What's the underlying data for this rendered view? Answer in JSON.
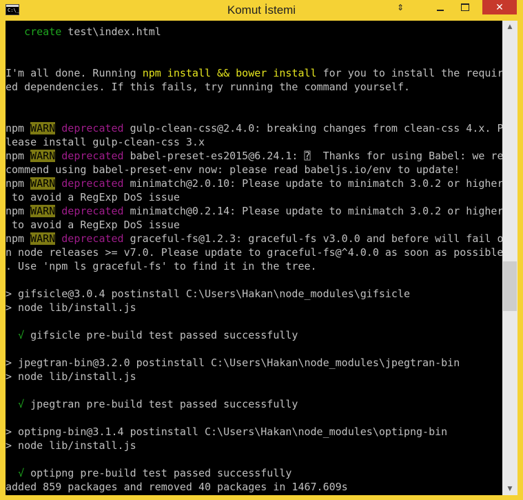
{
  "window": {
    "title": "Komut İstemi",
    "icon_text": "C:\\_",
    "controls": {
      "restore": "⇕",
      "close": "✕"
    }
  },
  "icons": {
    "app": "console-icon",
    "minimize": "minimize-icon",
    "maximize": "maximize-icon",
    "close": "close-icon"
  },
  "colors": {
    "console_bg": "#000000",
    "text": "#c0c0c0",
    "green": "#1ea51e",
    "yellow": "#e5e51f",
    "warn_bg": "#7e7a13",
    "magenta": "#a01c8c",
    "frame": "#f5d235",
    "close_btn": "#c7392c"
  },
  "console": {
    "lines": [
      [
        {
          "t": "   "
        },
        {
          "t": "create",
          "c": "green"
        },
        {
          "t": " test\\index.html"
        }
      ],
      [],
      [],
      [
        {
          "t": "I'm all done. Running "
        },
        {
          "t": "npm install && bower install",
          "c": "yellow"
        },
        {
          "t": " for you to install the requir"
        }
      ],
      [
        {
          "t": "ed dependencies. If this fails, try running the command yourself."
        }
      ],
      [],
      [],
      [
        {
          "t": "npm "
        },
        {
          "t": "WARN",
          "c": "warn"
        },
        {
          "t": " "
        },
        {
          "t": "deprecated",
          "c": "magenta"
        },
        {
          "t": " gulp-clean-css@2.4.0: breaking changes from clean-css 4.x. P"
        }
      ],
      [
        {
          "t": "lease install gulp-clean-css 3.x"
        }
      ],
      [
        {
          "t": "npm "
        },
        {
          "t": "WARN",
          "c": "warn"
        },
        {
          "t": " "
        },
        {
          "t": "deprecated",
          "c": "magenta"
        },
        {
          "t": " babel-preset-es2015@6.24.1: ⍰  Thanks for using Babel: we re"
        }
      ],
      [
        {
          "t": "commend using babel-preset-env now: please read babeljs.io/env to update!"
        }
      ],
      [
        {
          "t": "npm "
        },
        {
          "t": "WARN",
          "c": "warn"
        },
        {
          "t": " "
        },
        {
          "t": "deprecated",
          "c": "magenta"
        },
        {
          "t": " minimatch@2.0.10: Please update to minimatch 3.0.2 or higher"
        }
      ],
      [
        {
          "t": " to avoid a RegExp DoS issue"
        }
      ],
      [
        {
          "t": "npm "
        },
        {
          "t": "WARN",
          "c": "warn"
        },
        {
          "t": " "
        },
        {
          "t": "deprecated",
          "c": "magenta"
        },
        {
          "t": " minimatch@0.2.14: Please update to minimatch 3.0.2 or higher"
        }
      ],
      [
        {
          "t": " to avoid a RegExp DoS issue"
        }
      ],
      [
        {
          "t": "npm "
        },
        {
          "t": "WARN",
          "c": "warn"
        },
        {
          "t": " "
        },
        {
          "t": "deprecated",
          "c": "magenta"
        },
        {
          "t": " graceful-fs@1.2.3: graceful-fs v3.0.0 and before will fail o"
        }
      ],
      [
        {
          "t": "n node releases >= v7.0. Please update to graceful-fs@^4.0.0 as soon as possible"
        }
      ],
      [
        {
          "t": ". Use 'npm ls graceful-fs' to find it in the tree."
        }
      ],
      [],
      [
        {
          "t": "> gifsicle@3.0.4 postinstall C:\\Users\\Hakan\\node_modules\\gifsicle"
        }
      ],
      [
        {
          "t": "> node lib/install.js"
        }
      ],
      [],
      [
        {
          "t": "  "
        },
        {
          "t": "√",
          "c": "green"
        },
        {
          "t": " gifsicle pre-build test passed successfully"
        }
      ],
      [],
      [
        {
          "t": "> jpegtran-bin@3.2.0 postinstall C:\\Users\\Hakan\\node_modules\\jpegtran-bin"
        }
      ],
      [
        {
          "t": "> node lib/install.js"
        }
      ],
      [],
      [
        {
          "t": "  "
        },
        {
          "t": "√",
          "c": "green"
        },
        {
          "t": " jpegtran pre-build test passed successfully"
        }
      ],
      [],
      [
        {
          "t": "> optipng-bin@3.1.4 postinstall C:\\Users\\Hakan\\node_modules\\optipng-bin"
        }
      ],
      [
        {
          "t": "> node lib/install.js"
        }
      ],
      [],
      [
        {
          "t": "  "
        },
        {
          "t": "√",
          "c": "green"
        },
        {
          "t": " optipng pre-build test passed successfully"
        }
      ],
      [
        {
          "t": "added 859 packages and removed 40 packages in 1467.609s"
        }
      ]
    ]
  },
  "scrollbar": {
    "up_arrow": "▲",
    "down_arrow": "▼",
    "position": 0.57
  }
}
